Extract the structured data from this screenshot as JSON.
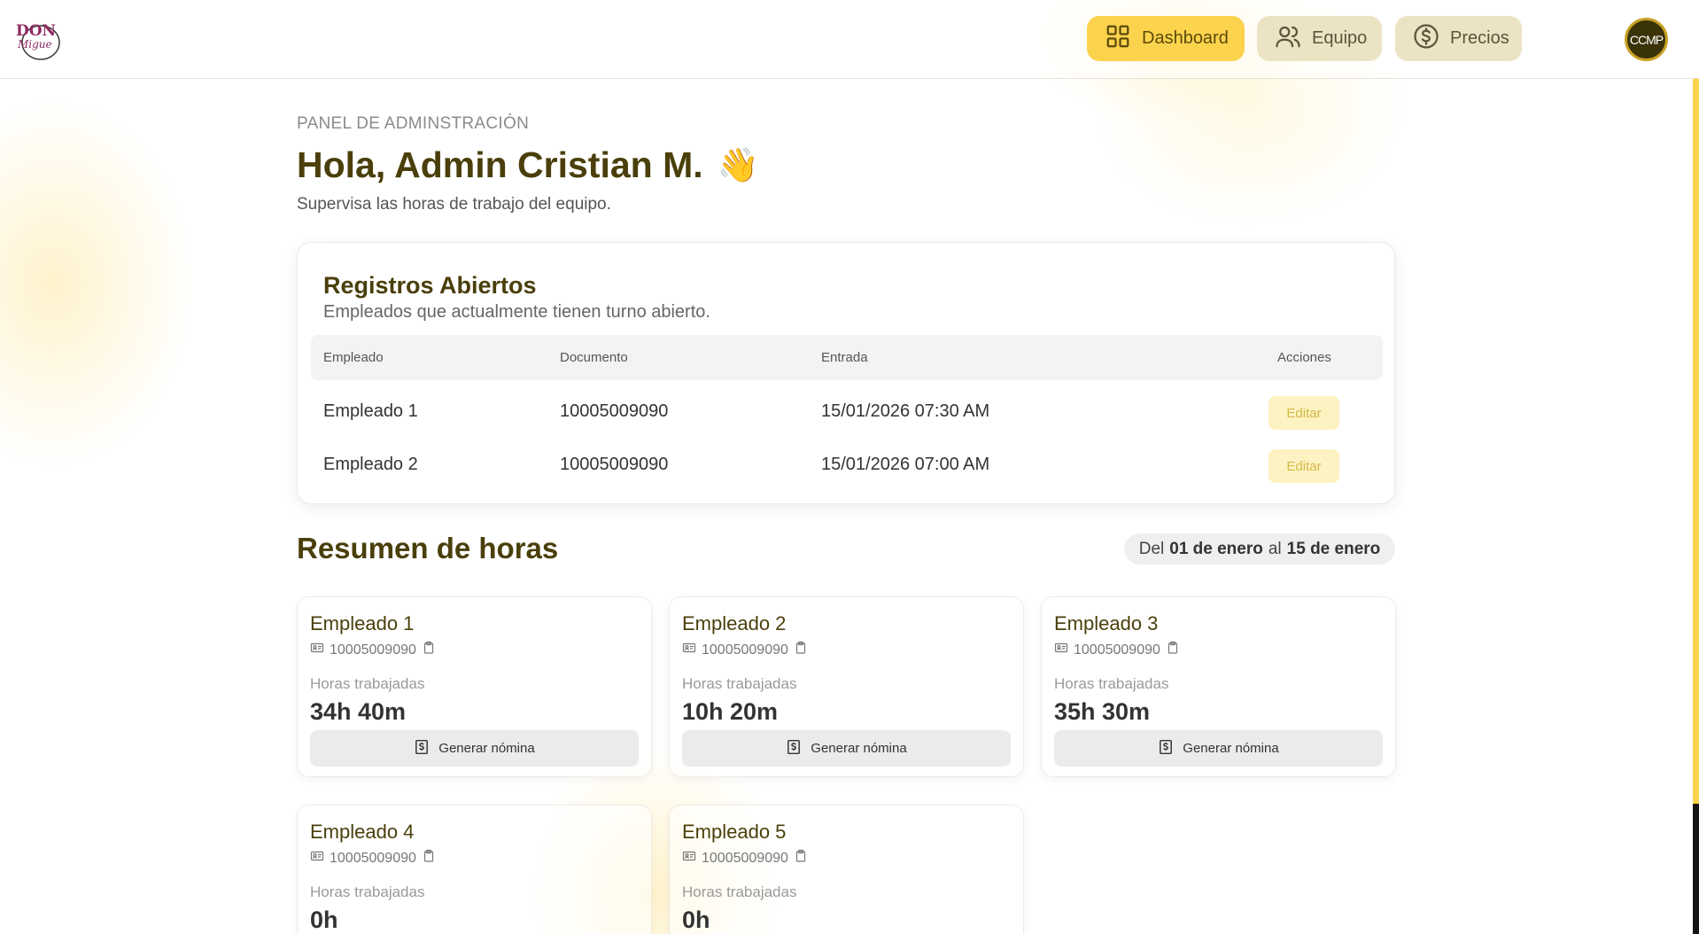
{
  "header": {
    "logo_text": "DON Migue",
    "nav": [
      {
        "label": "Dashboard",
        "icon": "grid-icon",
        "active": true
      },
      {
        "label": "Equipo",
        "icon": "users-icon",
        "active": false
      },
      {
        "label": "Precios",
        "icon": "dollar-circle-icon",
        "active": false
      }
    ],
    "avatar_initials": "CCMP"
  },
  "intro": {
    "eyebrow": "PANEL DE ADMINSTRACIÓN",
    "greeting": "Hola, Admin Cristian M.",
    "wave_emoji": "👋",
    "subtitle": "Supervisa las horas de trabajo del equipo."
  },
  "open_records": {
    "title": "Registros Abiertos",
    "subtitle": "Empleados que actualmente tienen turno abierto.",
    "columns": [
      "Empleado",
      "Documento",
      "Entrada",
      "Acciones"
    ],
    "rows": [
      {
        "employee": "Empleado 1",
        "document": "10005009090",
        "entry": "15/01/2026 07:30 AM",
        "action": "Editar"
      },
      {
        "employee": "Empleado 2",
        "document": "10005009090",
        "entry": "15/01/2026 07:00 AM",
        "action": "Editar"
      }
    ]
  },
  "summary": {
    "title": "Resumen de horas",
    "range_prefix": "Del",
    "range_start": "01 de enero",
    "range_mid": "al",
    "range_end": "15 de enero",
    "hours_label": "Horas trabajadas",
    "button_label": "Generar nómina",
    "employees": [
      {
        "name": "Empleado 1",
        "document": "10005009090",
        "hours": "34h 40m"
      },
      {
        "name": "Empleado 2",
        "document": "10005009090",
        "hours": "10h 20m"
      },
      {
        "name": "Empleado 3",
        "document": "10005009090",
        "hours": "35h 30m"
      },
      {
        "name": "Empleado 4",
        "document": "10005009090",
        "hours": "0h"
      },
      {
        "name": "Empleado 5",
        "document": "10005009090",
        "hours": "0h"
      }
    ]
  },
  "colors": {
    "accent": "#fcd34d",
    "heading": "#4a3f0b",
    "nav_inactive": "#ece3c4"
  }
}
